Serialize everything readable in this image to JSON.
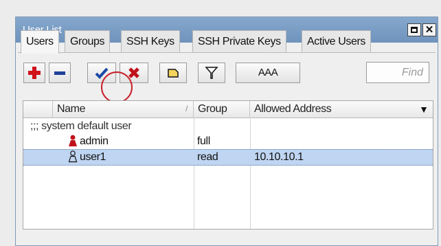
{
  "window": {
    "title": "User List"
  },
  "tabs": [
    {
      "label": "Users"
    },
    {
      "label": "Groups"
    },
    {
      "label": "SSH Keys"
    },
    {
      "label": "SSH Private Keys"
    },
    {
      "label": "Active Users"
    }
  ],
  "toolbar": {
    "aaa_label": "AAA",
    "find_placeholder": "Find",
    "icons": [
      "add-icon",
      "remove-icon",
      "enable-icon",
      "disable-icon",
      "comment-icon",
      "filter-icon"
    ]
  },
  "table": {
    "columns": [
      "Name",
      "Group",
      "Allowed Address"
    ],
    "section_label": ";;; system default user",
    "rows": [
      {
        "name": "admin",
        "group": "full",
        "allowed_address": "",
        "icon": "user-active-icon"
      },
      {
        "name": "user1",
        "group": "read",
        "allowed_address": "10.10.10.1",
        "icon": "user-outline-icon",
        "selected": true
      }
    ]
  },
  "colors": {
    "titlebar": "#7a9dc6",
    "selection": "#bfd5f1",
    "annotation": "#c8202a"
  }
}
